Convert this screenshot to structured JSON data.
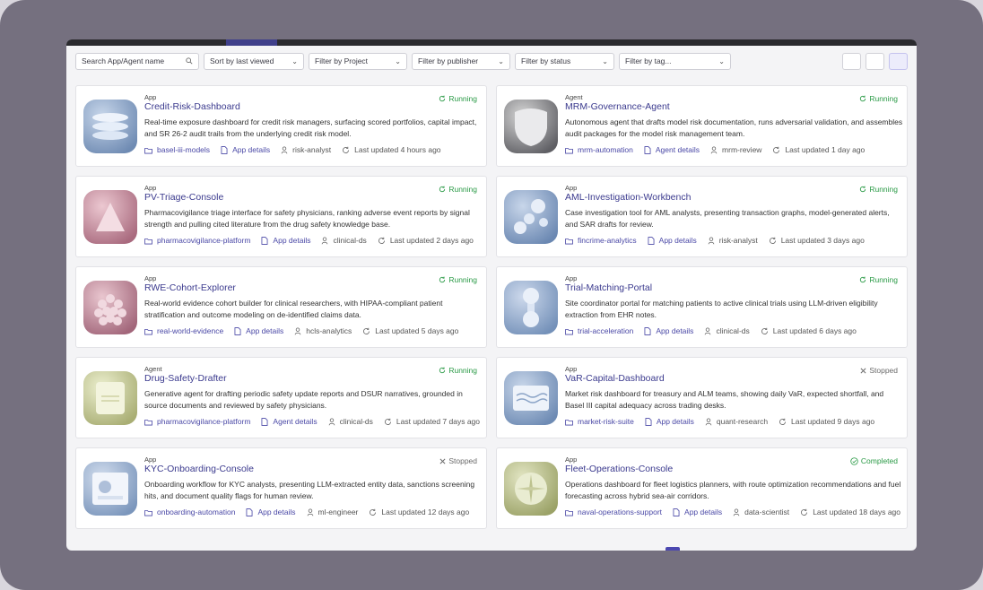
{
  "toolbar": {
    "search_placeholder": "Search App/Agent name",
    "sort_label": "Sort by last viewed",
    "project_label": "Filter by Project",
    "publisher_label": "Filter by publisher",
    "status_label": "Filter by status",
    "tag_label": "Filter by tag..."
  },
  "colors": {
    "running": "#2a9a46",
    "stopped": "#6a6a6a",
    "completed": "#2a9a46",
    "link": "#4a48a6",
    "title": "#3b3a8e"
  },
  "cards": [
    {
      "kind": "App",
      "title": "Credit-Risk-Dashboard",
      "status": "Running",
      "status_icon": "refresh-icon",
      "desc": "Real-time exposure dashboard for credit risk managers, surfacing scored portfolios, capital impact, and SR 26-2 audit trails from the underlying credit risk model.",
      "project": "basel-iii-models",
      "details": "App details",
      "owner": "risk-analyst",
      "updated": "Last updated 4 hours ago",
      "thumb": "database-icon"
    },
    {
      "kind": "Agent",
      "title": "MRM-Governance-Agent",
      "status": "Running",
      "status_icon": "refresh-icon",
      "desc": "Autonomous agent that drafts model risk documentation, runs adversarial validation, and assembles audit packages for the model risk management team.",
      "project": "mrm-automation",
      "details": "Agent details",
      "owner": "mrm-review",
      "updated": "Last updated 1 day ago",
      "thumb": "shield-icon"
    },
    {
      "kind": "App",
      "title": "PV-Triage-Console",
      "status": "Running",
      "status_icon": "refresh-icon",
      "desc": "Pharmacovigilance triage interface for safety physicians, ranking adverse event reports by signal strength and pulling cited literature from the drug safety knowledge base.",
      "project": "pharmacovigilance-platform",
      "details": "App details",
      "owner": "clinical-ds",
      "updated": "Last updated 2 days ago",
      "thumb": "triangle-icon"
    },
    {
      "kind": "App",
      "title": "AML-Investigation-Workbench",
      "status": "Running",
      "status_icon": "refresh-icon",
      "desc": "Case investigation tool for AML analysts, presenting transaction graphs, model-generated alerts, and SAR drafts for review.",
      "project": "fincrime-analytics",
      "details": "App details",
      "owner": "risk-analyst",
      "updated": "Last updated 3 days ago",
      "thumb": "molecule-icon"
    },
    {
      "kind": "App",
      "title": "RWE-Cohort-Explorer",
      "status": "Running",
      "status_icon": "refresh-icon",
      "desc": "Real-world evidence cohort builder for clinical researchers, with HIPAA-compliant patient stratification and outcome modeling on de-identified claims data.",
      "project": "real-world-evidence",
      "details": "App details",
      "owner": "hcls-analytics",
      "updated": "Last updated 5 days ago",
      "thumb": "cluster-icon"
    },
    {
      "kind": "App",
      "title": "Trial-Matching-Portal",
      "status": "Running",
      "status_icon": "refresh-icon",
      "desc": "Site coordinator portal for matching patients to active clinical trials using LLM-driven eligibility extraction from EHR notes.",
      "project": "trial-acceleration",
      "details": "App details",
      "owner": "clinical-ds",
      "updated": "Last updated 6 days ago",
      "thumb": "link-nodes-icon"
    },
    {
      "kind": "Agent",
      "title": "Drug-Safety-Drafter",
      "status": "Running",
      "status_icon": "refresh-icon",
      "desc": "Generative agent for drafting periodic safety update reports and DSUR narratives, grounded in source documents and reviewed by safety physicians.",
      "project": "pharmacovigilance-platform",
      "details": "Agent details",
      "owner": "clinical-ds",
      "updated": "Last updated 7 days ago",
      "thumb": "document-icon"
    },
    {
      "kind": "App",
      "title": "VaR-Capital-Dashboard",
      "status": "Stopped",
      "status_icon": "close-icon",
      "desc": "Market risk dashboard for treasury and ALM teams, showing daily VaR, expected shortfall, and Basel III capital adequacy across trading desks.",
      "project": "market-risk-suite",
      "details": "App details",
      "owner": "quant-research",
      "updated": "Last updated 9 days ago",
      "thumb": "wave-icon"
    },
    {
      "kind": "App",
      "title": "KYC-Onboarding-Console",
      "status": "Stopped",
      "status_icon": "close-icon",
      "desc": "Onboarding workflow for KYC analysts, presenting LLM-extracted entity data, sanctions screening hits, and document quality flags for human review.",
      "project": "onboarding-automation",
      "details": "App details",
      "owner": "ml-engineer",
      "updated": "Last updated 12 days ago",
      "thumb": "id-card-icon"
    },
    {
      "kind": "App",
      "title": "Fleet-Operations-Console",
      "status": "Completed",
      "status_icon": "check-circle-icon",
      "desc": "Operations dashboard for fleet logistics planners, with route optimization recommendations and fuel forecasting across hybrid sea-air corridors.",
      "project": "naval-operations-support",
      "details": "App details",
      "owner": "data-scientist",
      "updated": "Last updated 18 days ago",
      "thumb": "compass-icon"
    }
  ]
}
